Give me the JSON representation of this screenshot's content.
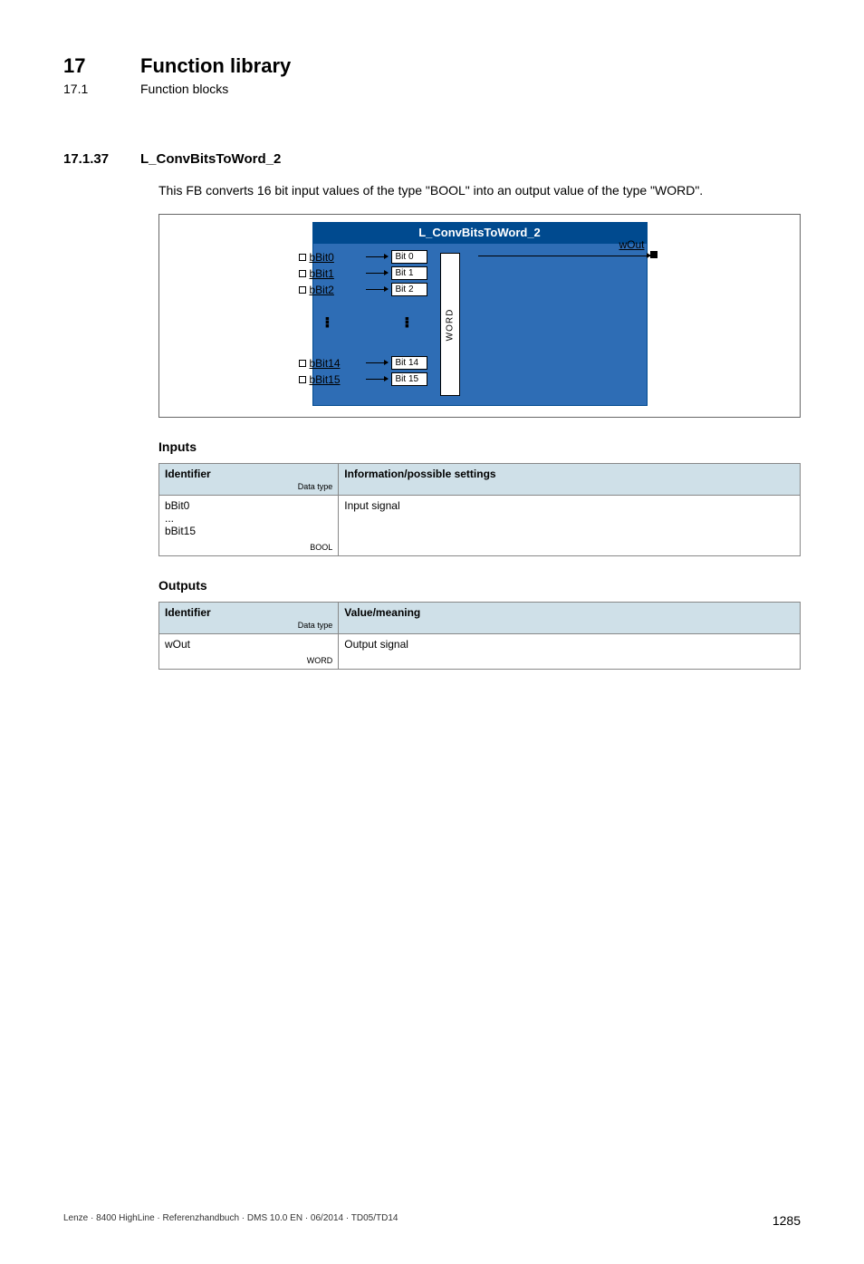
{
  "header": {
    "chapter_num": "17",
    "chapter_title": "Function library",
    "sub_num": "17.1",
    "sub_title": "Function blocks"
  },
  "section": {
    "num": "17.1.37",
    "title": "L_ConvBitsToWord_2",
    "description": "This FB converts 16 bit input values of the type \"BOOL\" into an output value of the type \"WORD\"."
  },
  "diagram": {
    "title": "L_ConvBitsToWord_2",
    "inputs_top": [
      "bBit0",
      "bBit1",
      "bBit2"
    ],
    "inputs_bottom": [
      "bBit14",
      "bBit15"
    ],
    "bits_top": [
      "Bit 0",
      "Bit 1",
      "Bit 2"
    ],
    "bits_bottom": [
      "Bit 14",
      "Bit 15"
    ],
    "word_label": "WORD",
    "output": "wOut"
  },
  "inputs_table": {
    "heading": "Inputs",
    "col_identifier": "Identifier",
    "col_info": "Information/possible settings",
    "data_type_label": "Data type",
    "row_identifier_lines": [
      "bBit0",
      "...",
      "bBit15"
    ],
    "row_datatype": "BOOL",
    "row_info": "Input signal"
  },
  "outputs_table": {
    "heading": "Outputs",
    "col_identifier": "Identifier",
    "col_value": "Value/meaning",
    "data_type_label": "Data type",
    "row_identifier": "wOut",
    "row_datatype": "WORD",
    "row_value": "Output signal"
  },
  "footer": {
    "left": "Lenze · 8400 HighLine · Referenzhandbuch · DMS 10.0 EN · 06/2014 · TD05/TD14",
    "page": "1285"
  }
}
